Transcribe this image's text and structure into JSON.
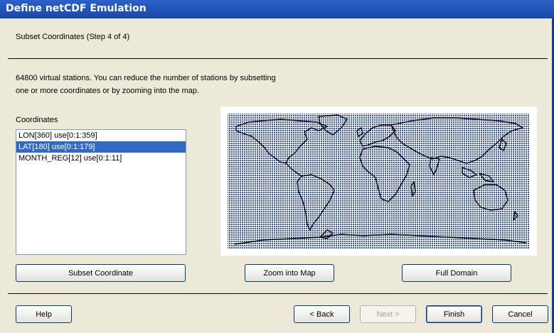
{
  "window": {
    "title": "Define netCDF Emulation"
  },
  "step": "Subset Coordinates (Step 4 of 4)",
  "description": {
    "line1": "64800 virtual stations. You can reduce the number of stations by subsetting",
    "line2": "one or more coordinates or by zooming into the map."
  },
  "coordinates": {
    "label": "Coordinates",
    "items": [
      {
        "label": "LON[360]  use[0:1:359]",
        "selected": false
      },
      {
        "label": "LAT[180]  use[0:1:179]",
        "selected": true
      },
      {
        "label": "MONTH_REG[12]  use[0:1:11]",
        "selected": false
      }
    ]
  },
  "buttons": {
    "subset": "Subset Coordinate",
    "zoom": "Zoom into Map",
    "full": "Full Domain",
    "help": "Help",
    "back": "< Back",
    "next": "Next >",
    "finish": "Finish",
    "cancel": "Cancel"
  },
  "map": {
    "content": "world-map",
    "station_color": "#3b55a8"
  }
}
